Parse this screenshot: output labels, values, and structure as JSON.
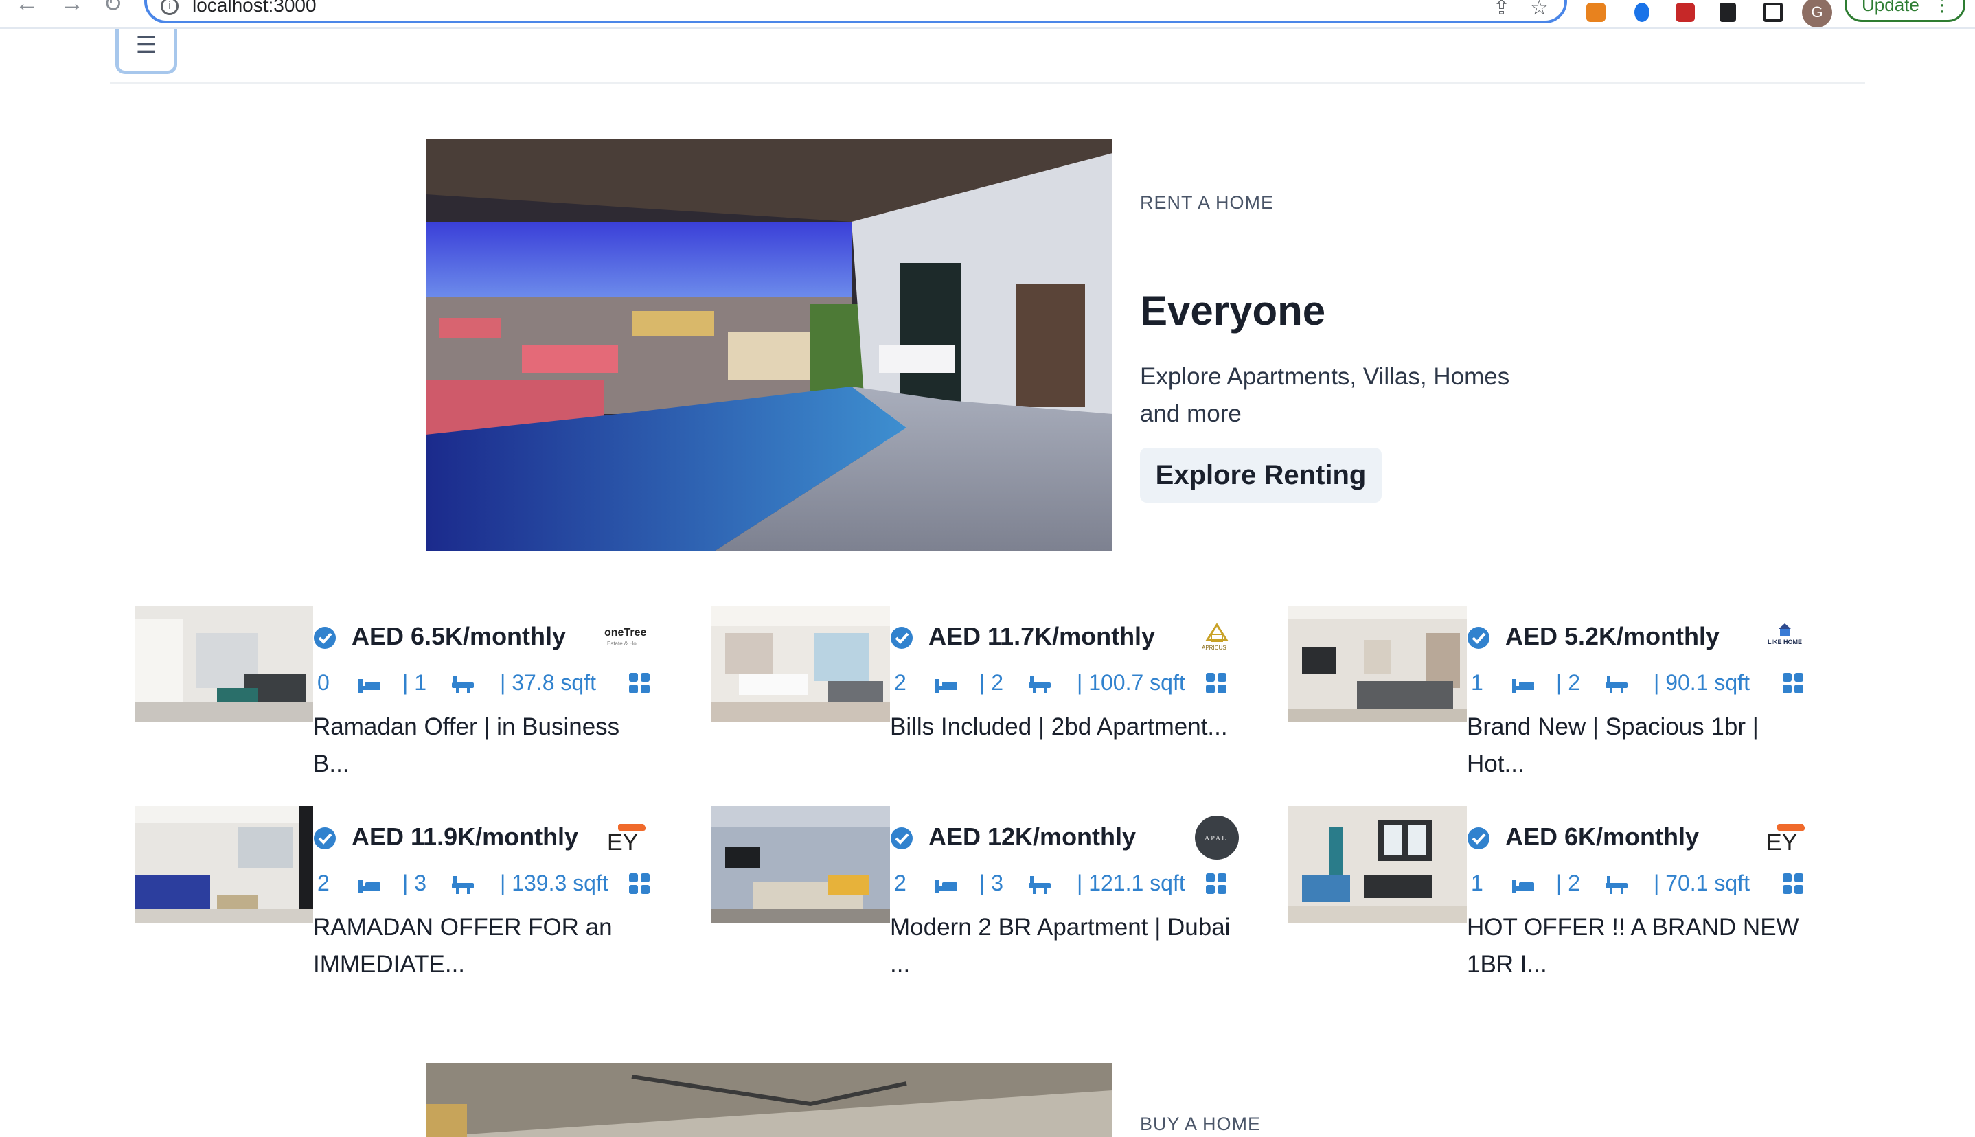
{
  "browser": {
    "url": "localhost:3000",
    "update_label": "Update",
    "avatar_initial": "G"
  },
  "header": {
    "menu_icon": "☰"
  },
  "hero": {
    "eyebrow": "RENT A HOME",
    "title": "Everyone",
    "description": "Explore Apartments, Villas, Homes and more",
    "button_label": "Explore Renting"
  },
  "listings": [
    {
      "price": "AED 6.5K/monthly",
      "beds": "0",
      "baths": "| 1",
      "area": "| 37.8 sqft",
      "title": "Ramadan Offer | in Business B...",
      "agency": "oneTree"
    },
    {
      "price": "AED 11.7K/monthly",
      "beds": "2",
      "baths": "| 2",
      "area": "| 100.7 sqft",
      "title": "Bills Included | 2bd Apartment...",
      "agency": "APRICUS"
    },
    {
      "price": "AED 5.2K/monthly",
      "beds": "1",
      "baths": "| 2",
      "area": "| 90.1 sqft",
      "title": "Brand New | Spacious 1br | Hot...",
      "agency": "LIKE HOME"
    },
    {
      "price": "AED 11.9K/monthly",
      "beds": "2",
      "baths": "| 3",
      "area": "| 139.3 sqft",
      "title": "RAMADAN OFFER FOR an IMMEDIATE...",
      "agency": "KEY"
    },
    {
      "price": "AED 12K/monthly",
      "beds": "2",
      "baths": "| 3",
      "area": "| 121.1 sqft",
      "title": "Modern 2 BR Apartment | Dubai ...",
      "agency": "APAL"
    },
    {
      "price": "AED 6K/monthly",
      "beds": "1",
      "baths": "| 2",
      "area": "| 70.1 sqft",
      "title": "HOT OFFER !! A BRAND NEW 1BR I...",
      "agency": "KEY"
    }
  ],
  "hero2": {
    "eyebrow": "BUY A HOME"
  }
}
